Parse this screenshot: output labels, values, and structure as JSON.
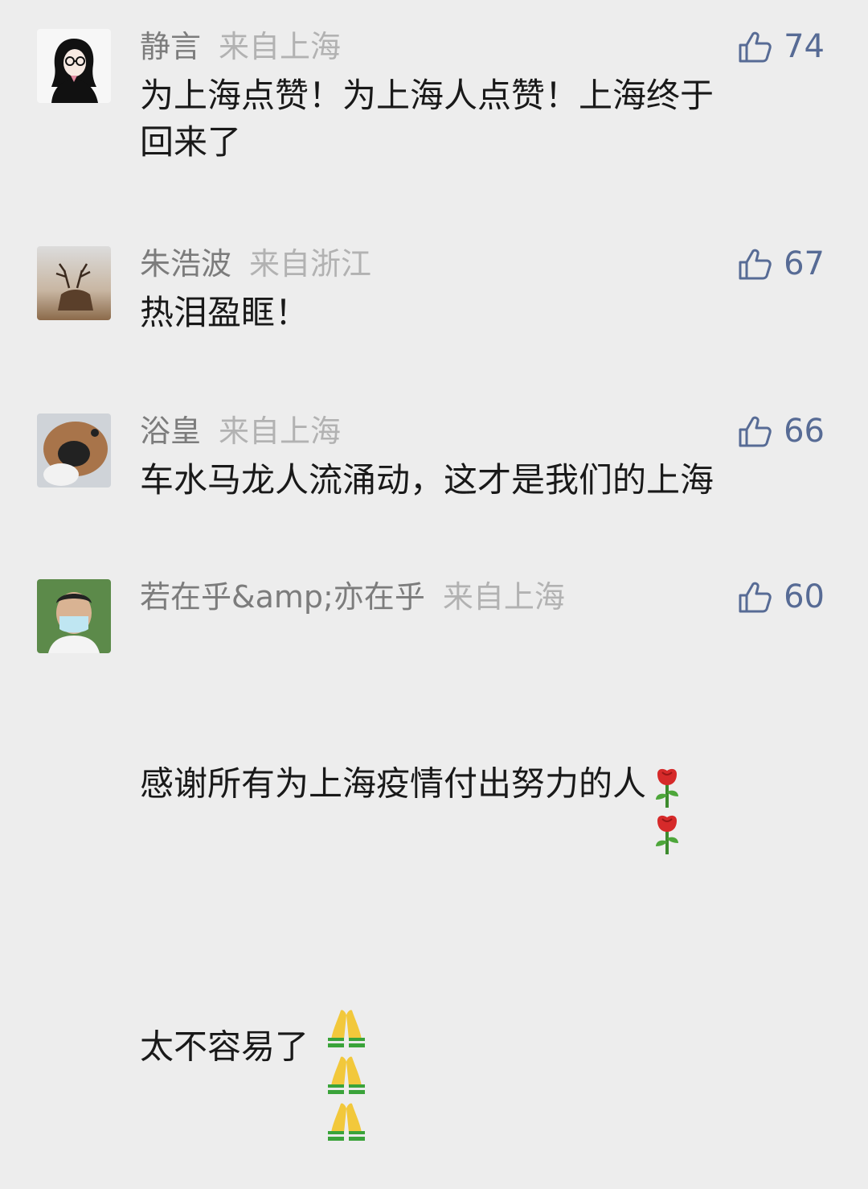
{
  "comments": [
    {
      "name": "静言",
      "location": "来自上海",
      "likes": "74",
      "text": "为上海点赞！为上海人点赞！上海终于\n回来了"
    },
    {
      "name": "朱浩波",
      "location": "来自浙江",
      "likes": "67",
      "text": "热泪盈眶！"
    },
    {
      "name": "浴皇",
      "location": "来自上海",
      "likes": "66",
      "text": "车水马龙人流涌动，这才是我们的上海"
    },
    {
      "name": "若在乎&amp;亦在乎",
      "location": "来自上海",
      "likes": "60",
      "text": "感谢所有为上海疫情付出努力的人",
      "text2": "太不容易了"
    }
  ],
  "icons": {
    "like": "thumbs-up-icon",
    "rose": "rose-emoji",
    "pray": "folded-hands-emoji"
  },
  "colors": {
    "background": "#ededed",
    "like": "#576b95",
    "name": "#7c7c7c",
    "location": "#b2b2b2",
    "text": "#191919"
  }
}
